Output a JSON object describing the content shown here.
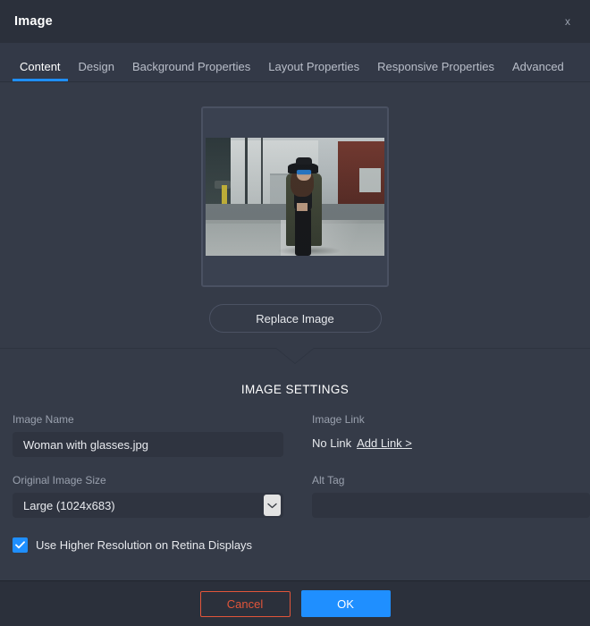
{
  "window": {
    "title": "Image",
    "close_label": "x"
  },
  "tabs": [
    {
      "label": "Content",
      "active": true
    },
    {
      "label": "Design",
      "active": false
    },
    {
      "label": "Background Properties",
      "active": false
    },
    {
      "label": "Layout Properties",
      "active": false
    },
    {
      "label": "Responsive Properties",
      "active": false
    },
    {
      "label": "Advanced",
      "active": false
    }
  ],
  "preview": {
    "alt_description": "Woman with hat and blue sunglasses standing on a city street",
    "replace_label": "Replace Image"
  },
  "settings": {
    "heading": "IMAGE SETTINGS",
    "image_name": {
      "label": "Image Name",
      "value": "Woman with glasses.jpg",
      "placeholder": ""
    },
    "image_link": {
      "label": "Image Link",
      "status": "No Link",
      "action": "Add Link >"
    },
    "original_image_size": {
      "label": "Original Image Size",
      "value": "Large (1024x683)"
    },
    "alt_tag": {
      "label": "Alt Tag",
      "value": "",
      "placeholder": ""
    },
    "retina": {
      "label": "Use Higher Resolution on Retina Displays",
      "checked": true
    }
  },
  "footer": {
    "cancel_label": "Cancel",
    "ok_label": "OK"
  },
  "colors": {
    "accent_blue": "#1f8fff",
    "cancel_red": "#e2553a",
    "panel_bg": "#353b48",
    "titlebar_bg": "#2b303b"
  }
}
